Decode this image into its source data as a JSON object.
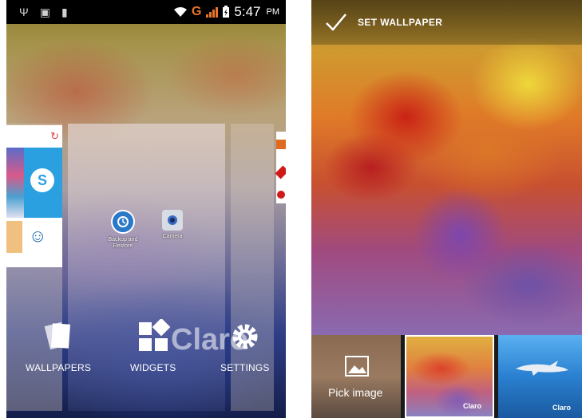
{
  "left_screen": {
    "status_bar": {
      "notification_icons": [
        "usb-icon",
        "image-icon",
        "barcode-icon"
      ],
      "network_label": "G",
      "time": "5:47",
      "ampm": "PM"
    },
    "home_apps": [
      {
        "label": "Backup and Restore",
        "icon": "backup-restore-icon"
      },
      {
        "label": "Camera",
        "icon": "camera-icon"
      }
    ],
    "dock": {
      "wallpapers_label": "WALLPAPERS",
      "widgets_label": "WIDGETS",
      "settings_label": "SETTINGS"
    },
    "watermark": "Claro"
  },
  "right_screen": {
    "action_bar": {
      "title": "SET WALLPAPER"
    },
    "thumbnails": {
      "pick_image_label": "Pick image",
      "claro_label": "Claro"
    }
  },
  "colors": {
    "status_bar_bg": "#000000",
    "network_accent": "#e8752a",
    "thumb_selected_border": "#ffffff"
  }
}
